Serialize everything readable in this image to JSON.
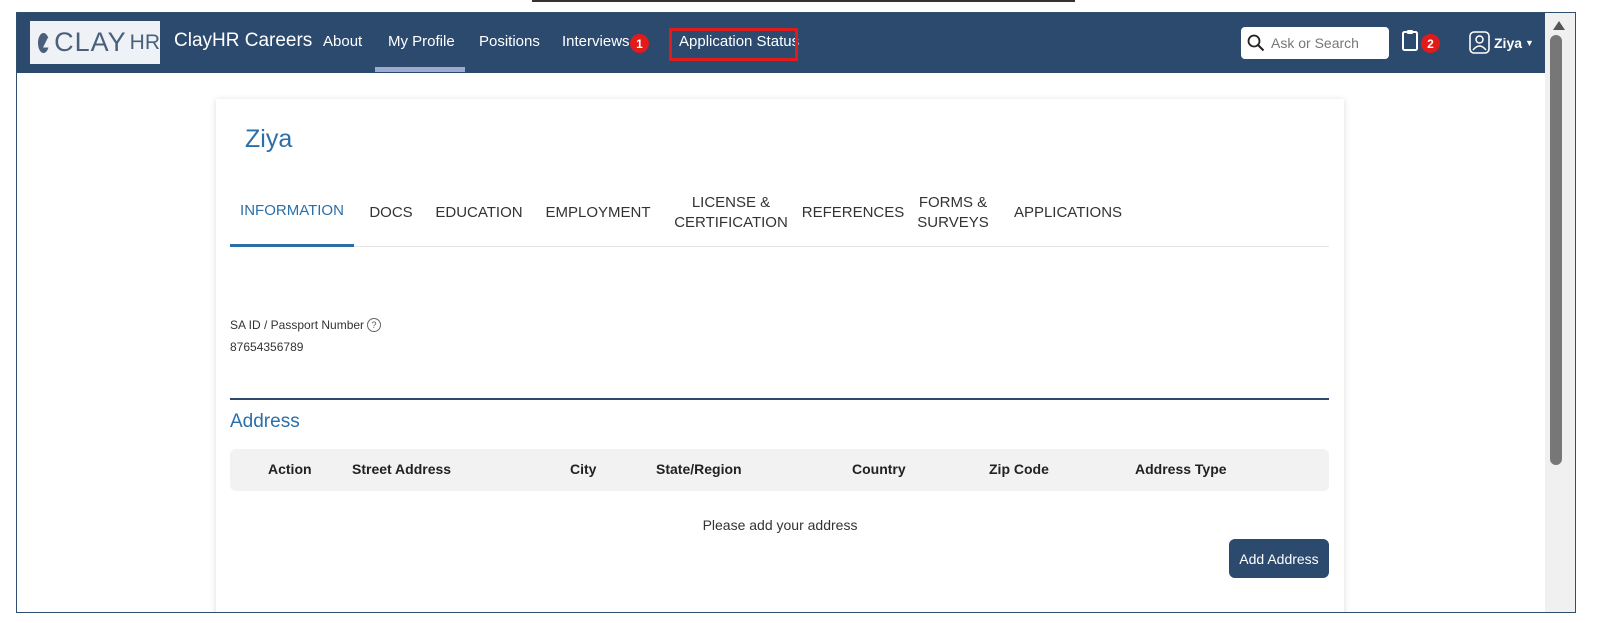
{
  "header": {
    "logo_text": "CLAY",
    "logo_suffix": "HR",
    "brand": "ClayHR Careers",
    "nav": [
      {
        "label": "About"
      },
      {
        "label": "My Profile"
      },
      {
        "label": "Positions"
      },
      {
        "label": "Interviews",
        "badge": "1"
      },
      {
        "label": "Application Status"
      }
    ],
    "search": {
      "placeholder": "Ask or Search"
    },
    "clipboard_badge": "2",
    "user_name": "Ziya",
    "colors": {
      "navbar": "#2b4a6e",
      "badge": "#e11a1a",
      "highlight": "#e01b1b"
    }
  },
  "profile": {
    "name": "Ziya",
    "tabs": [
      {
        "line1": "INFORMATION",
        "line2": ""
      },
      {
        "line1": "DOCS",
        "line2": ""
      },
      {
        "line1": "EDUCATION",
        "line2": ""
      },
      {
        "line1": "EMPLOYMENT",
        "line2": ""
      },
      {
        "line1": "LICENSE &",
        "line2": "CERTIFICATION"
      },
      {
        "line1": "REFERENCES",
        "line2": ""
      },
      {
        "line1": "FORMS &",
        "line2": "SURVEYS"
      },
      {
        "line1": "APPLICATIONS",
        "line2": ""
      }
    ],
    "active_tab": "INFORMATION",
    "id_field": {
      "label": "SA ID / Passport Number",
      "value": "87654356789",
      "help_icon": "question-circle-icon"
    },
    "address": {
      "title": "Address",
      "columns": [
        "Action",
        "Street Address",
        "City",
        "State/Region",
        "Country",
        "Zip Code",
        "Address Type"
      ],
      "empty_message": "Please add your address",
      "add_button": "Add Address"
    }
  }
}
